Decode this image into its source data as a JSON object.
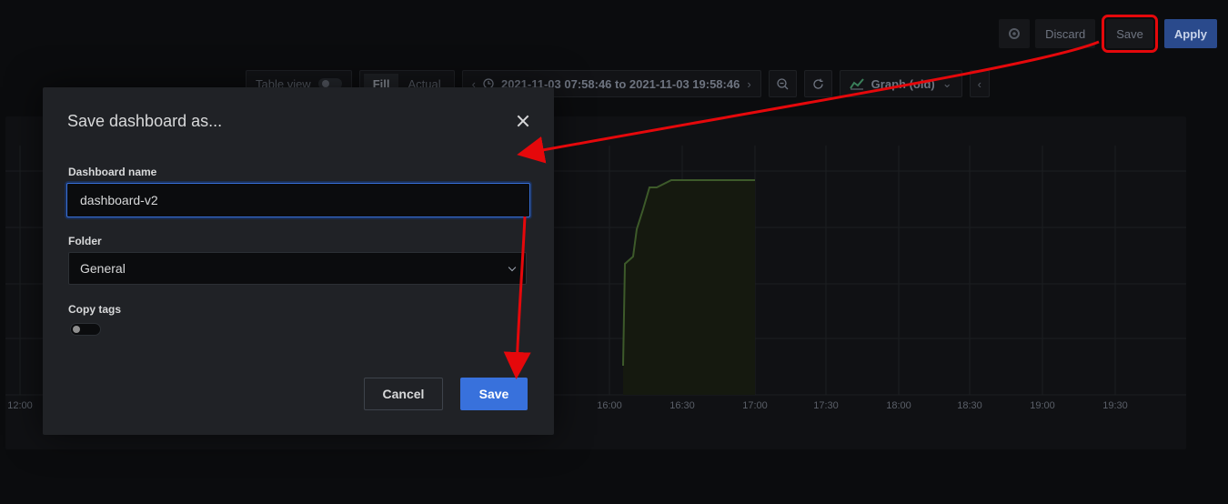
{
  "top_toolbar": {
    "discard_label": "Discard",
    "save_label": "Save",
    "apply_label": "Apply"
  },
  "panel_toolbar": {
    "table_view_label": "Table view",
    "fill_label": "Fill",
    "actual_label": "Actual",
    "time_range": "2021-11-03 07:58:46 to 2021-11-03 19:58:46",
    "visualization_label": "Graph (old)"
  },
  "graph": {
    "x_ticks": [
      "12:00",
      "16:00",
      "16:30",
      "17:00",
      "17:30",
      "18:00",
      "18:30",
      "19:00",
      "19:30"
    ],
    "series_color": "#3d5a2a"
  },
  "modal": {
    "title": "Save dashboard as...",
    "name_label": "Dashboard name",
    "name_value": "dashboard-v2",
    "folder_label": "Folder",
    "folder_value": "General",
    "copy_tags_label": "Copy tags",
    "copy_tags_enabled": false,
    "cancel_label": "Cancel",
    "save_label": "Save"
  },
  "colors": {
    "primary": "#3871dc",
    "annotation": "#e5080b"
  }
}
